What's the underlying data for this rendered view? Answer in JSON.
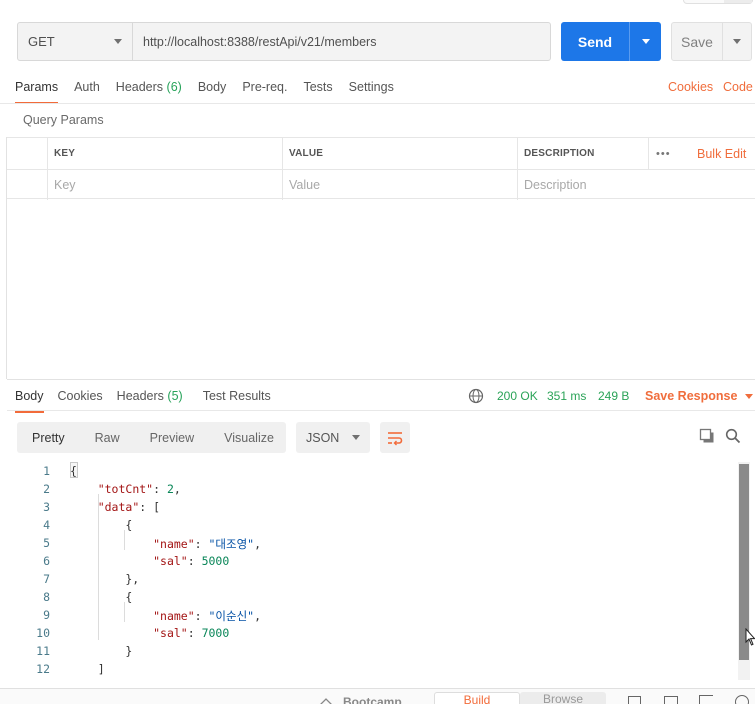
{
  "request": {
    "method": "GET",
    "url": "http://localhost:8388/restApi/v21/members",
    "send_label": "Send",
    "save_label": "Save"
  },
  "request_tabs": [
    {
      "label": "Params",
      "active": true
    },
    {
      "label": "Auth"
    },
    {
      "label": "Headers",
      "count": "(6)"
    },
    {
      "label": "Body"
    },
    {
      "label": "Pre-req."
    },
    {
      "label": "Tests"
    },
    {
      "label": "Settings"
    }
  ],
  "request_links": {
    "cookies": "Cookies",
    "code": "Code"
  },
  "query_params": {
    "title": "Query Params",
    "headers": {
      "key": "KEY",
      "value": "VALUE",
      "description": "DESCRIPTION"
    },
    "more": "•••",
    "bulk_edit": "Bulk Edit",
    "placeholders": {
      "key": "Key",
      "value": "Value",
      "description": "Description"
    }
  },
  "response_tabs": [
    {
      "label": "Body",
      "active": true
    },
    {
      "label": "Cookies"
    },
    {
      "label": "Headers",
      "count": "(5)"
    },
    {
      "label": "Test Results"
    }
  ],
  "response_status": {
    "status": "200 OK",
    "time": "351 ms",
    "size": "249 B",
    "save_response": "Save Response"
  },
  "view_modes": [
    "Pretty",
    "Raw",
    "Preview",
    "Visualize"
  ],
  "format": "JSON",
  "code_lines": [
    {
      "n": "1",
      "text": "{"
    },
    {
      "n": "2",
      "text": "    \"totCnt\": 2,"
    },
    {
      "n": "3",
      "text": "    \"data\": ["
    },
    {
      "n": "4",
      "text": "        {"
    },
    {
      "n": "5",
      "text": "            \"name\": \"대조영\","
    },
    {
      "n": "6",
      "text": "            \"sal\": 5000"
    },
    {
      "n": "7",
      "text": "        },"
    },
    {
      "n": "8",
      "text": "        {"
    },
    {
      "n": "9",
      "text": "            \"name\": \"이순신\","
    },
    {
      "n": "10",
      "text": "            \"sal\": 7000"
    },
    {
      "n": "11",
      "text": "        }"
    },
    {
      "n": "12",
      "text": "    ]"
    }
  ],
  "bottom_bar": {
    "bootcamp": "Bootcamp",
    "build": "Build",
    "browse": "Browse"
  },
  "colors": {
    "accent": "#f26b3a",
    "primary": "#1d77e8",
    "success": "#2aa357"
  }
}
